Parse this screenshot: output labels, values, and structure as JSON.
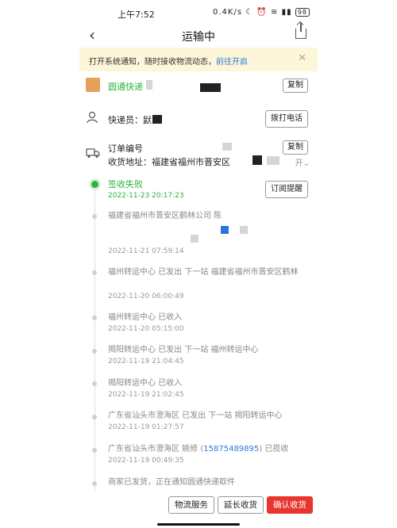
{
  "status_bar": {
    "time": "上午7:52",
    "net": "0.4K/s",
    "battery": "98"
  },
  "nav": {
    "title": "运输中"
  },
  "notice": {
    "text": "打开系统通知，随时接收物流动态，",
    "link": "前往开启"
  },
  "courier_company": {
    "name": "圆通快递",
    "copy_label": "复制"
  },
  "courier_person": {
    "label": "快递员：",
    "name_visible": "鼣",
    "call_label": "拨打电话"
  },
  "order": {
    "number_label": "订单编号",
    "address_label": "收货地址：福建省福州市晋安区",
    "copy_label": "复制",
    "expand_label": "开"
  },
  "timeline": [
    {
      "title": "签收失败",
      "time": "2022-11-23 20:17:23",
      "active": true,
      "action_label": "订阅提醒"
    },
    {
      "title": "福建省福州市晋安区鹤林公司 陈",
      "time": "2022-11-21 07:59:14"
    },
    {
      "title": "福州转运中心 已发出 下一站 福建省福州市晋安区鹤林",
      "time": "2022-11-20 06:00:49"
    },
    {
      "title": "福州转运中心 已收入",
      "time": "2022-11-20 05:15:00"
    },
    {
      "title": "揭阳转运中心 已发出 下一站 福州转运中心",
      "time": "2022-11-19 21:04:45"
    },
    {
      "title": "揭阳转运中心 已收入",
      "time": "2022-11-19 21:02:45"
    },
    {
      "title": "广东省汕头市澄海区 已发出 下一站 揭阳转运中心",
      "time": "2022-11-19 01:27:57"
    },
    {
      "title_prefix": "广东省汕头市澄海区 姚修 (",
      "phone": "15875489895",
      "title_suffix": ") 已揽收",
      "time": "2022-11-19 00:49:35"
    },
    {
      "title": "商家已发货，正在通知圆通快递取件",
      "time": ""
    }
  ],
  "bottom_bar": {
    "logistics_label": "物流服务",
    "extend_label": "延长收货",
    "confirm_label": "确认收货"
  },
  "colors": {
    "accent_green": "#2fb340",
    "link_blue": "#2a7bd8",
    "confirm_red": "#e8352e",
    "notice_bg": "#fdf6d8"
  }
}
